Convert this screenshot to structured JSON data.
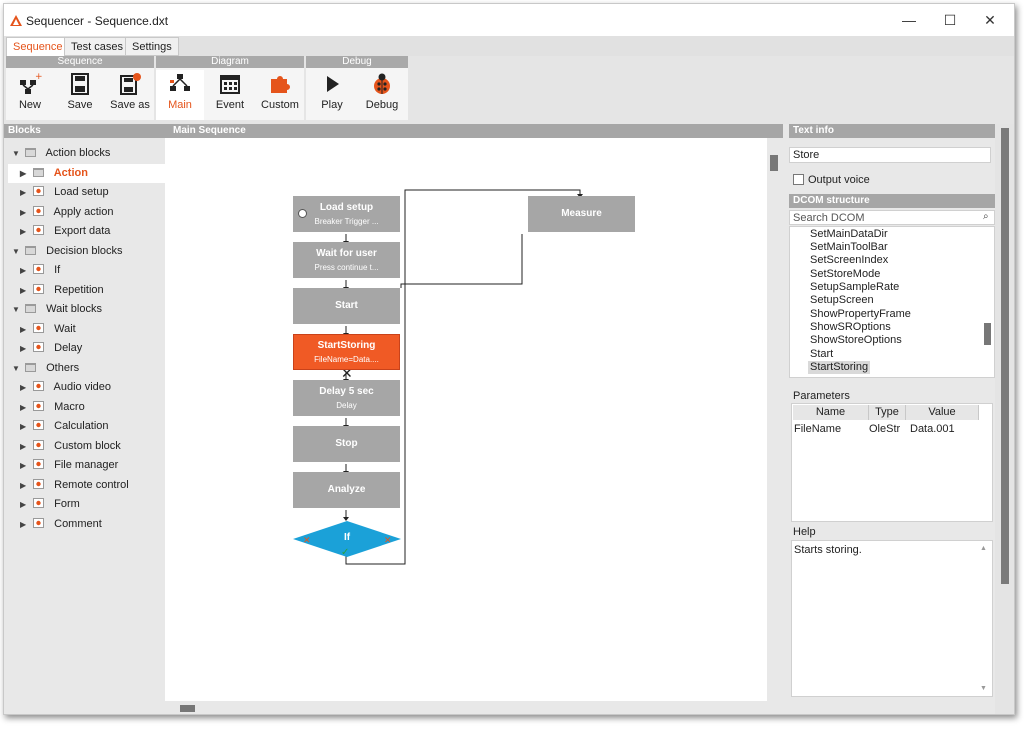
{
  "window": {
    "title": "Sequencer - Sequence.dxt",
    "minimize": "—",
    "maximize": "☐",
    "close": "✕"
  },
  "tabs": [
    {
      "label": "Sequence",
      "active": true
    },
    {
      "label": "Test cases",
      "active": false
    },
    {
      "label": "Settings",
      "active": false
    }
  ],
  "ribbon": {
    "groups": [
      {
        "label": "Sequence"
      },
      {
        "label": "Diagram"
      },
      {
        "label": "Debug"
      }
    ],
    "buttons": {
      "new": "New",
      "save": "Save",
      "save_as": "Save as",
      "main": "Main",
      "event": "Event",
      "custom": "Custom",
      "play": "Play",
      "debug": "Debug"
    }
  },
  "blocks_panel": {
    "header": "Blocks",
    "items": [
      {
        "label": "Action blocks"
      },
      {
        "label": "Action"
      },
      {
        "label": "Load setup"
      },
      {
        "label": "Apply action"
      },
      {
        "label": "Export data"
      },
      {
        "label": "Decision blocks"
      },
      {
        "label": "If"
      },
      {
        "label": "Repetition"
      },
      {
        "label": "Wait blocks"
      },
      {
        "label": "Wait"
      },
      {
        "label": "Delay"
      },
      {
        "label": "Others"
      },
      {
        "label": "Audio video"
      },
      {
        "label": "Macro"
      },
      {
        "label": "Calculation"
      },
      {
        "label": "Custom block"
      },
      {
        "label": "File manager"
      },
      {
        "label": "Remote control"
      },
      {
        "label": "Form"
      },
      {
        "label": "Comment"
      }
    ]
  },
  "canvas": {
    "header": "Main Sequence",
    "nodes": {
      "load_setup": {
        "title": "Load setup",
        "sub": "Breaker Trigger ..."
      },
      "wait_for_user": {
        "title": "Wait for user",
        "sub": "Press continue t..."
      },
      "start": {
        "title": "Start"
      },
      "start_storing": {
        "title": "StartStoring",
        "sub": "FileName=Data...."
      },
      "delay": {
        "title": "Delay 5 sec",
        "sub": "Delay"
      },
      "stop": {
        "title": "Stop"
      },
      "analyze": {
        "title": "Analyze"
      },
      "if": {
        "title": "If"
      },
      "measure": {
        "title": "Measure"
      }
    },
    "colors": {
      "block": "#a6a6a6",
      "selected": "#f05a25",
      "decision": "#1ba1d8"
    }
  },
  "text_info": {
    "header": "Text info",
    "value": "Store",
    "output_voice_label": "Output voice",
    "output_voice_checked": false
  },
  "dcom": {
    "header": "DCOM structure",
    "search_placeholder": "Search DCOM",
    "items": [
      {
        "label": "SetMainDataDir"
      },
      {
        "label": "SetMainToolBar"
      },
      {
        "label": "SetScreenIndex"
      },
      {
        "label": "SetStoreMode"
      },
      {
        "label": "SetupSampleRate"
      },
      {
        "label": "SetupScreen"
      },
      {
        "label": "ShowPropertyFrame"
      },
      {
        "label": "ShowSROptions"
      },
      {
        "label": "ShowStoreOptions"
      },
      {
        "label": "Start"
      },
      {
        "label": "StartStoring",
        "selected": true
      }
    ]
  },
  "parameters": {
    "label": "Parameters",
    "columns": [
      "Name",
      "Type",
      "Value"
    ],
    "rows": [
      {
        "name": "FileName",
        "type": "OleStr",
        "value": "Data.001"
      }
    ]
  },
  "help": {
    "label": "Help",
    "text": "Starts storing."
  }
}
